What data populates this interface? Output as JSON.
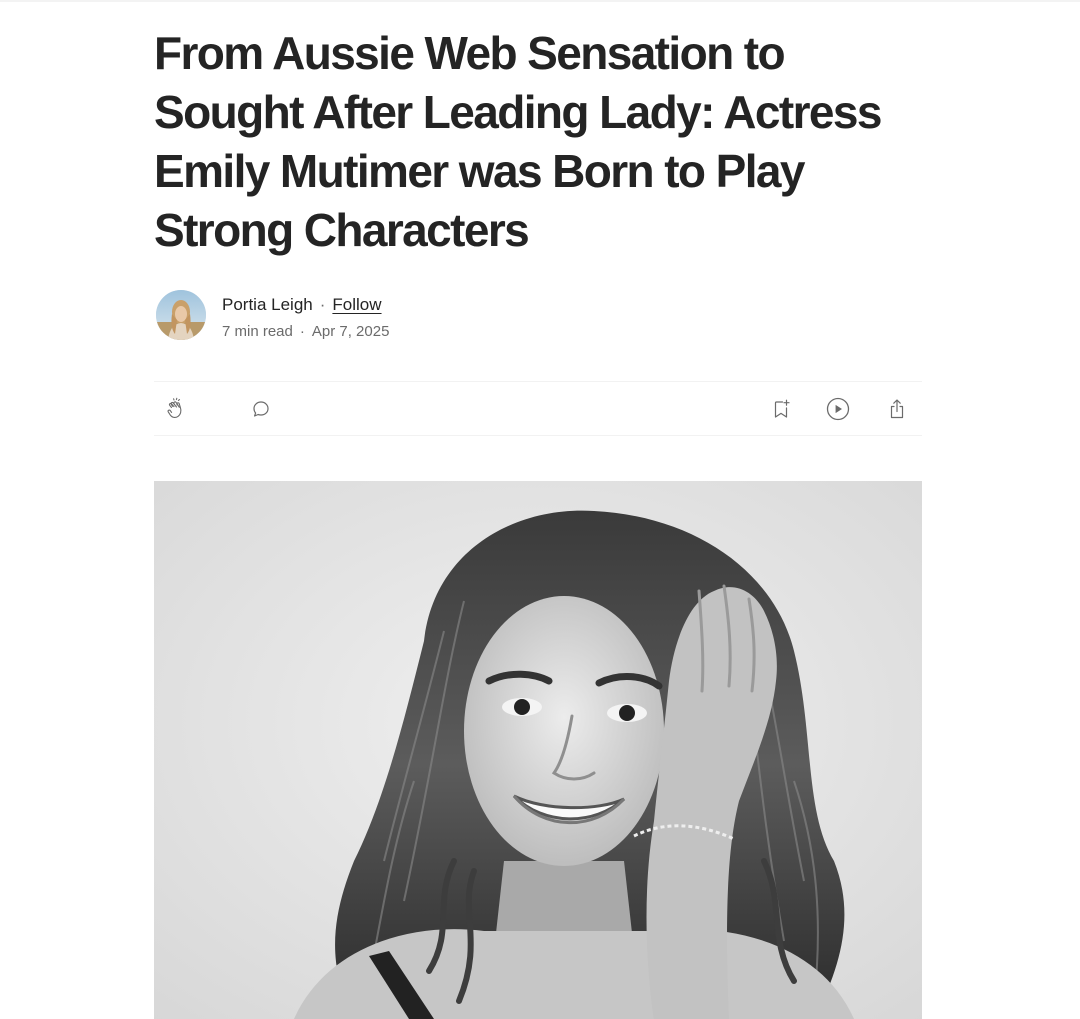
{
  "article": {
    "title": "From Aussie Web Sensation to Sought After Leading Lady: Actress Emily Mutimer was Born to Play Strong Characters"
  },
  "byline": {
    "author_name": "Portia Leigh",
    "separator": "·",
    "follow_label": "Follow",
    "read_time": "7 min read",
    "date": "Apr 7, 2025"
  },
  "actions": {
    "icons": [
      "clap-icon",
      "comment-icon",
      "bookmark-add-icon",
      "play-listen-icon",
      "share-icon"
    ]
  },
  "theme": {
    "text": "#242424",
    "muted": "#6b6b6b",
    "divider": "#f2f2f2"
  }
}
